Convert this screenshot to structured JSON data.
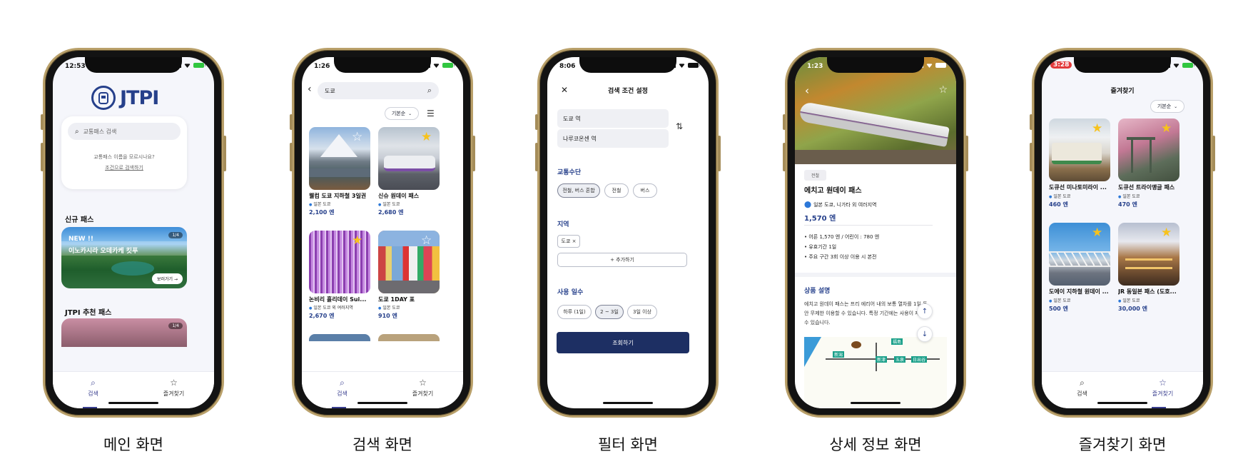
{
  "captions": [
    "메인 화면",
    "검색 화면",
    "필터 화면",
    "상세 정보 화면",
    "즐겨찾기 화면"
  ],
  "tabs": {
    "search": "검색",
    "favorites": "즐겨찾기"
  },
  "main": {
    "time": "12:53",
    "logo": "JTPI",
    "search_placeholder": "교통패스 검색",
    "hint": "교통패스 이름을 모르시나요?",
    "condition_link": "조건으로 검색하기",
    "new_section": "신규 패스",
    "banner_badge": "NEW !!",
    "banner_title": "이노카시라 오데카케 킷푸",
    "banner_counter": "1/4",
    "banner_button": "보러가기 →",
    "recommend_section": "JTPI 추천 패스",
    "recommend_counter": "1/4"
  },
  "search": {
    "time": "1:26",
    "query": "도쿄",
    "sort": "기본순",
    "items": [
      {
        "title": "웰컴 도쿄 지하철 3일권",
        "loc": "일본 도쿄",
        "price": "2,100 엔",
        "fav": false
      },
      {
        "title": "신슈 원데이 패스",
        "loc": "일본 도쿄",
        "price": "2,680 엔",
        "fav": true
      },
      {
        "title": "논비리 흘리데이 Sui...",
        "loc": "일본 도쿄 외 여러지역",
        "price": "2,670 엔",
        "fav": true
      },
      {
        "title": "도쿄 1DAY 표",
        "loc": "일본 도쿄",
        "price": "910 엔",
        "fav": false
      }
    ]
  },
  "filter": {
    "time": "8:06",
    "title": "검색 조건 설정",
    "from_station": "도쿄 역",
    "to_station": "나루코온센 역",
    "transport_label": "교통수단",
    "transport_options": [
      "전철, 버스 혼합",
      "전철",
      "버스"
    ],
    "region_label": "지역",
    "region_tag": "도쿄 ×",
    "add_button": "+ 추가하기",
    "days_label": "사용 일수",
    "days_options": [
      "하루 (1일)",
      "2 ~ 3일",
      "3일 이상"
    ],
    "submit": "조회하기"
  },
  "detail": {
    "time": "1:23",
    "category": "전철",
    "title": "에치고 원데이 패스",
    "location": "일본 도쿄, 니가타 외 여러지역",
    "price": "1,570 엔",
    "bullets": [
      "어른 1,570 엔 / 어린이 : 780 엔",
      "유효기간 1일",
      "주요 구간 3회 이상 이용 시 본전"
    ],
    "desc_title": "상품 설명",
    "desc_text": "에치고 원데이 패스는 프리 에리어 내의 보통 열차를 1일 동안 무제한 이용할 수 있습니다. 특정 기간에는 사용이 제한될 수 있습니다.",
    "map_labels": [
      "新潟",
      "福島",
      "新津",
      "五泉",
      "日出谷"
    ]
  },
  "favorites": {
    "time": "3:28",
    "title": "즐겨찾기",
    "sort": "기본순",
    "items": [
      {
        "title": "도큐선 미나토미라이 ...",
        "loc": "일본 도쿄",
        "price": "460 엔"
      },
      {
        "title": "도큐선 트라이앵글 패스",
        "loc": "일본 도쿄",
        "price": "470 엔"
      },
      {
        "title": "도에이 지하철 원데이 ...",
        "loc": "일본 도쿄",
        "price": "500 엔"
      },
      {
        "title": "JR 동일본 패스 (도호...",
        "loc": "일본 도쿄",
        "price": "30,000 엔"
      }
    ]
  }
}
